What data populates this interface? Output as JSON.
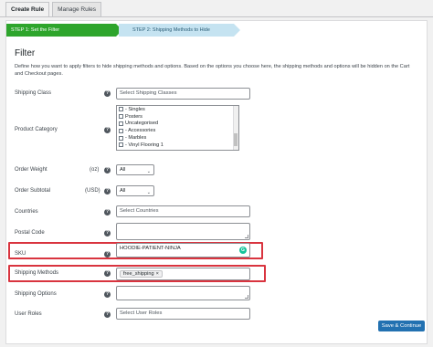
{
  "tabs": [
    {
      "label": "Create Rule",
      "active": true
    },
    {
      "label": "Manage Rules",
      "active": false
    }
  ],
  "steps": [
    {
      "label": "STEP 1: Set the Filter",
      "active": true,
      "color": "#2ea52c"
    },
    {
      "label": "STEP 2: Shipping Methods to Hide",
      "active": false,
      "color": "#c5e3f1"
    }
  ],
  "filter": {
    "heading": "Filter",
    "description": "Define how you want to apply filters to hide shipping methods and options. Based on the options you choose here, the shipping methods and options will be hidden on the Cart and Checkout pages."
  },
  "fields": {
    "shipping_class": {
      "label": "Shipping Class",
      "placeholder": "Select Shipping Classes"
    },
    "product_category": {
      "label": "Product Category",
      "options": [
        "- Singles",
        "Posters",
        "Uncategorised",
        "- Accessories",
        "- Marbles",
        "- Vinyl Flooring 1"
      ]
    },
    "order_weight": {
      "label": "Order Weight",
      "unit": "(oz)",
      "selected": "All"
    },
    "order_subtotal": {
      "label": "Order Subtotal",
      "unit": "(USD)",
      "selected": "All"
    },
    "countries": {
      "label": "Countries",
      "placeholder": "Select Countries"
    },
    "postal_code": {
      "label": "Postal Code",
      "value": ""
    },
    "sku": {
      "label": "SKU",
      "value": "HOODIE-PATIENT-NINJA"
    },
    "shipping_methods": {
      "label": "Shipping Methods",
      "tags": [
        "free_shipping"
      ]
    },
    "shipping_options": {
      "label": "Shipping Options",
      "value": ""
    },
    "user_roles": {
      "label": "User Roles",
      "placeholder": "Select User Roles"
    }
  },
  "buttons": {
    "save": "Save & Continue"
  },
  "colors": {
    "accent": "#2271b1",
    "highlight": "#d9343f",
    "step_active": "#2ea52c",
    "step_inactive": "#c5e3f1"
  },
  "icons": {
    "help": "question-circle-icon",
    "grammarly": "grammarly-icon",
    "remove": "close-icon",
    "chevron": "chevron-down-icon"
  }
}
